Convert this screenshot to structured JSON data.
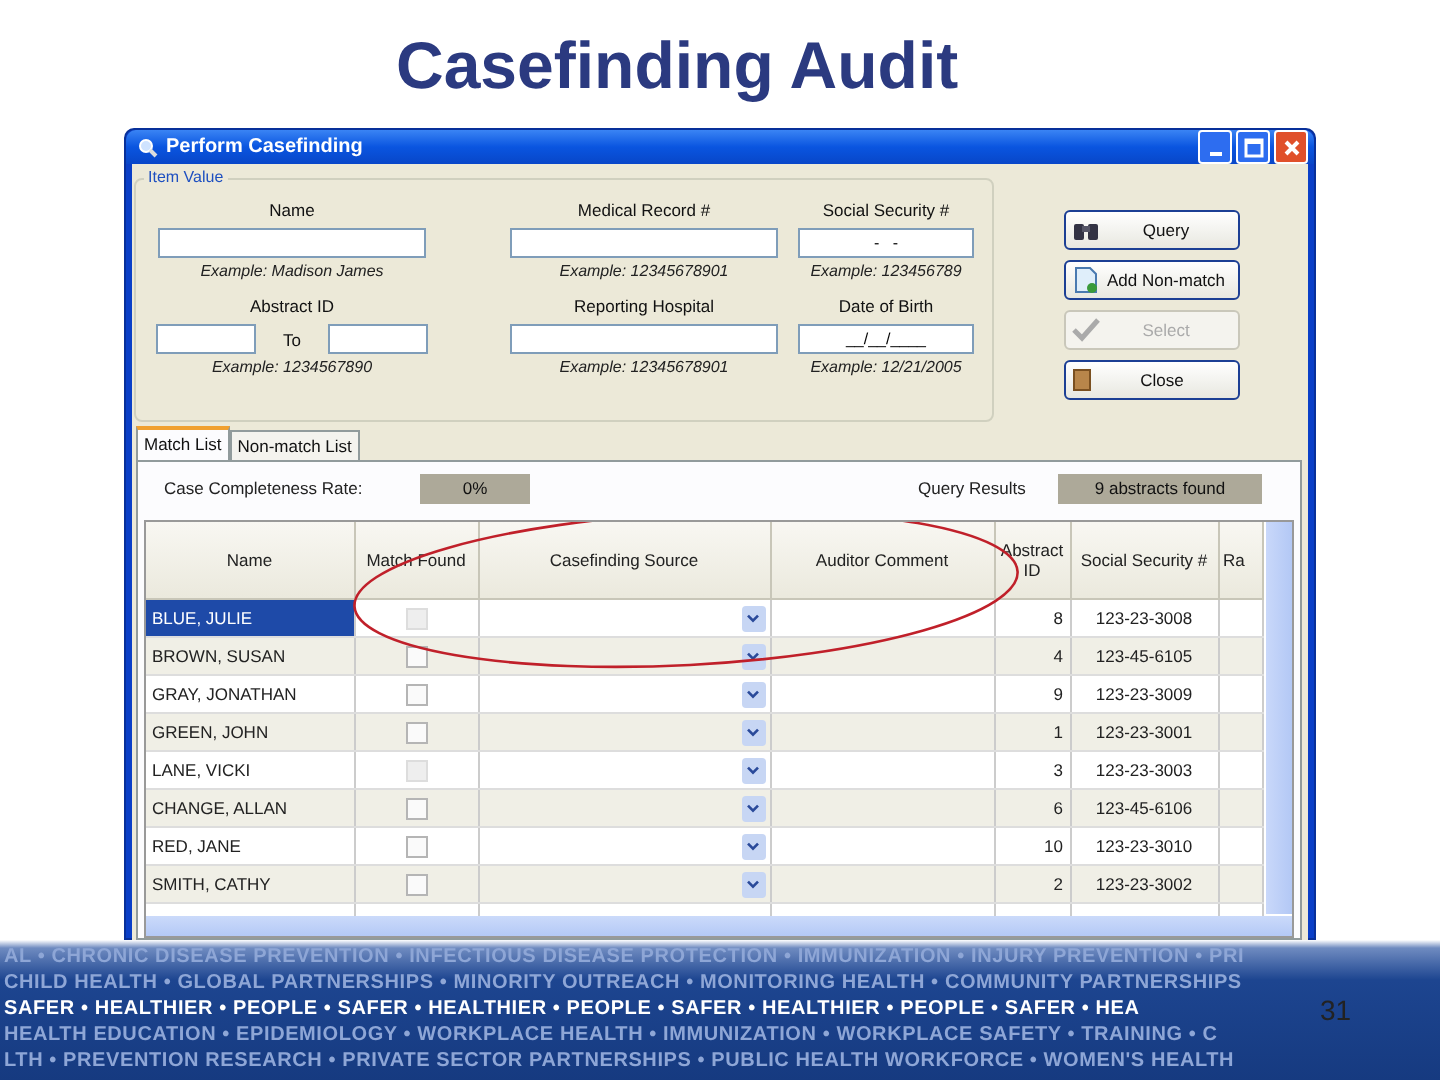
{
  "slide": {
    "title": "Casefinding Audit",
    "page_number": "31"
  },
  "window": {
    "title": "Perform Casefinding"
  },
  "item_value": {
    "legend": "Item Value",
    "fields": [
      {
        "kind": "text",
        "label": "Name",
        "example": "Example: Madison James"
      },
      {
        "kind": "text",
        "label": "Medical Record #",
        "example": "Example: 12345678901"
      },
      {
        "kind": "text",
        "label": "Social Security #",
        "value": "-   -",
        "example": "Example: 123456789"
      },
      {
        "kind": "range",
        "label": "Abstract ID",
        "separator": "To",
        "example": "Example: 1234567890"
      },
      {
        "kind": "text",
        "label": "Reporting Hospital",
        "example": "Example: 12345678901"
      },
      {
        "kind": "text",
        "label": "Date of Birth",
        "value": "__/__/____",
        "example": "Example: 12/21/2005"
      }
    ]
  },
  "buttons": [
    {
      "label": "Query",
      "disabled": false
    },
    {
      "label": "Add Non-match",
      "disabled": false
    },
    {
      "label": "Select",
      "disabled": true
    },
    {
      "label": "Close",
      "disabled": false
    }
  ],
  "tabs": [
    {
      "label": "Match List",
      "selected": true
    },
    {
      "label": "Non-match List",
      "selected": false
    }
  ],
  "summary": {
    "completeness_label": "Case Completeness Rate:",
    "completeness_value": "0%",
    "results_label": "Query Results",
    "results_value": "9 abstracts found"
  },
  "table": {
    "columns": [
      "Name",
      "Match Found",
      "Casefinding Source",
      "Auditor Comment",
      "Abstract ID",
      "Social Security #",
      "Ra"
    ],
    "rows": [
      {
        "name": "BLUE, JULIE",
        "selected": true,
        "checked": false,
        "disabled": true,
        "abstract_id": "8",
        "ssn": "123-23-3008"
      },
      {
        "name": "BROWN, SUSAN",
        "selected": false,
        "checked": false,
        "disabled": false,
        "abstract_id": "4",
        "ssn": "123-45-6105"
      },
      {
        "name": "GRAY, JONATHAN",
        "selected": false,
        "checked": false,
        "disabled": false,
        "abstract_id": "9",
        "ssn": "123-23-3009"
      },
      {
        "name": "GREEN, JOHN",
        "selected": false,
        "checked": false,
        "disabled": false,
        "abstract_id": "1",
        "ssn": "123-23-3001"
      },
      {
        "name": "LANE, VICKI",
        "selected": false,
        "checked": false,
        "disabled": true,
        "abstract_id": "3",
        "ssn": "123-23-3003"
      },
      {
        "name": "CHANGE, ALLAN",
        "selected": false,
        "checked": false,
        "disabled": false,
        "abstract_id": "6",
        "ssn": "123-45-6106"
      },
      {
        "name": "RED, JANE",
        "selected": false,
        "checked": false,
        "disabled": false,
        "abstract_id": "10",
        "ssn": "123-23-3010"
      },
      {
        "name": "SMITH, CATHY",
        "selected": false,
        "checked": false,
        "disabled": false,
        "abstract_id": "2",
        "ssn": "123-23-3002"
      }
    ]
  },
  "banner": {
    "lines": [
      {
        "kind": "plain",
        "text": "AL • CHRONIC DISEASE PREVENTION • INFECTIOUS DISEASE PROTECTION • IMMUNIZATION • INJURY PREVENTION • PRI"
      },
      {
        "kind": "plain",
        "text": "CHILD HEALTH • GLOBAL PARTNERSHIPS • MINORITY OUTREACH • MONITORING HEALTH • COMMUNITY PARTNERSHIPS"
      },
      {
        "kind": "bold",
        "text": "SAFER • HEALTHIER • PEOPLE • SAFER • HEALTHIER • PEOPLE • SAFER • HEALTHIER • PEOPLE • SAFER • HEA"
      },
      {
        "kind": "plain",
        "text": "HEALTH EDUCATION • EPIDEMIOLOGY • WORKPLACE HEALTH • IMMUNIZATION • WORKPLACE SAFETY • TRAINING • C"
      },
      {
        "kind": "plain",
        "text": "LTH • PREVENTION RESEARCH • PRIVATE SECTOR PARTNERSHIPS • PUBLIC HEALTH WORKFORCE • WOMEN'S HEALTH"
      }
    ]
  }
}
